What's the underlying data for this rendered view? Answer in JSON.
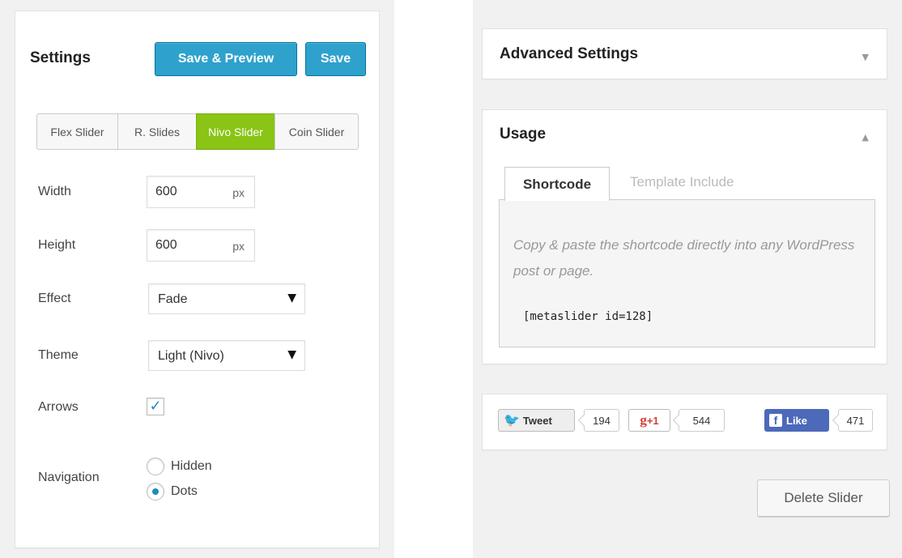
{
  "settings": {
    "title": "Settings",
    "save_preview_label": "Save & Preview",
    "save_label": "Save",
    "slider_tabs": [
      {
        "label": "Flex Slider",
        "active": false
      },
      {
        "label": "R. Slides",
        "active": false
      },
      {
        "label": "Nivo Slider",
        "active": true
      },
      {
        "label": "Coin Slider",
        "active": false
      }
    ],
    "width": {
      "label": "Width",
      "value": "600",
      "unit": "px"
    },
    "height": {
      "label": "Height",
      "value": "600",
      "unit": "px"
    },
    "effect": {
      "label": "Effect",
      "value": "Fade"
    },
    "theme": {
      "label": "Theme",
      "value": "Light (Nivo)"
    },
    "arrows": {
      "label": "Arrows",
      "checked": true
    },
    "navigation": {
      "label": "Navigation",
      "options": [
        {
          "label": "Hidden",
          "checked": false
        },
        {
          "label": "Dots",
          "checked": true
        }
      ]
    }
  },
  "advanced": {
    "title": "Advanced Settings"
  },
  "usage": {
    "title": "Usage",
    "tabs": [
      {
        "label": "Shortcode",
        "active": true
      },
      {
        "label": "Template Include",
        "active": false
      }
    ],
    "description": "Copy & paste the shortcode directly into any WordPress post or page.",
    "shortcode": "[metaslider id=128]"
  },
  "social": {
    "tweet_label": "Tweet",
    "tweet_count": "194",
    "gplus_label": "+1",
    "gplus_count": "544",
    "fb_label": "Like",
    "fb_count": "471"
  },
  "delete_label": "Delete Slider",
  "colors": {
    "primary_button": "#2ea2cc",
    "active_tab": "#8ac414",
    "facebook": "#4c69ba",
    "gplus": "#d73d32"
  }
}
